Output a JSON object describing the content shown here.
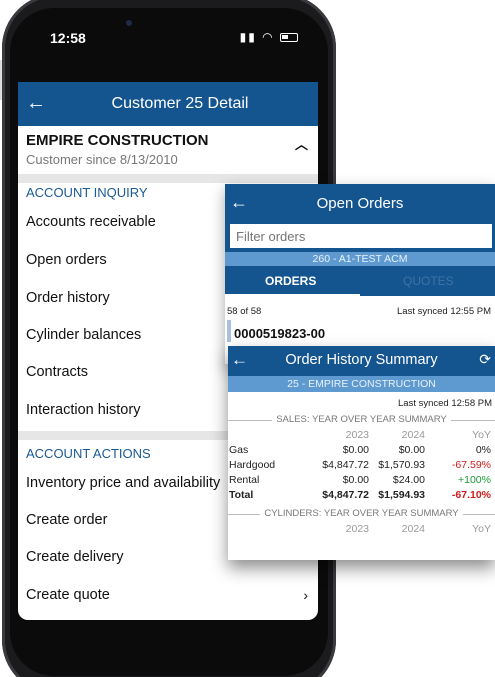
{
  "status_bar": {
    "time": "12:58"
  },
  "customer_screen": {
    "title": "Customer 25 Detail",
    "customer_name": "EMPIRE CONSTRUCTION",
    "customer_since": "Customer since 8/13/2010",
    "account_inquiry": {
      "heading": "ACCOUNT INQUIRY",
      "items": [
        "Accounts receivable",
        "Open orders",
        "Order history",
        "Cylinder balances",
        "Contracts",
        "Interaction history"
      ]
    },
    "account_actions": {
      "heading": "ACCOUNT ACTIONS",
      "items": [
        "Inventory price and availability",
        "Create order",
        "Create delivery",
        "Create quote"
      ]
    }
  },
  "open_orders": {
    "title": "Open Orders",
    "filter_placeholder": "Filter orders",
    "location": "260 - A1-TEST ACM",
    "tabs": [
      "ORDERS",
      "QUOTES"
    ],
    "count": "58 of 58",
    "last_synced": "Last synced 12:55 PM",
    "first_order": "0000519823-00"
  },
  "order_history": {
    "title": "Order History Summary",
    "customer": "25 - EMPIRE CONSTRUCTION",
    "last_synced": "Last synced 12:58 PM",
    "sales_section": "SALES: YEAR OVER YEAR SUMMARY",
    "columns": [
      "2023",
      "2024",
      "YoY"
    ],
    "rows": [
      {
        "label": "Gas",
        "y2023": "$0.00",
        "y2024": "$0.00",
        "yoy": "0%",
        "trend": "flat"
      },
      {
        "label": "Hardgood",
        "y2023": "$4,847.72",
        "y2024": "$1,570.93",
        "yoy": "-67.59%",
        "trend": "down"
      },
      {
        "label": "Rental",
        "y2023": "$0.00",
        "y2024": "$24.00",
        "yoy": "+100%",
        "trend": "up"
      },
      {
        "label": "Total",
        "y2023": "$4,847.72",
        "y2024": "$1,594.93",
        "yoy": "-67.10%",
        "trend": "down"
      }
    ],
    "cylinders_section": "CYLINDERS: YEAR OVER YEAR SUMMARY",
    "cylinder_columns": [
      "2023",
      "2024",
      "YoY"
    ]
  },
  "colors": {
    "header_blue": "#14548f",
    "strip_blue": "#5e9ad0",
    "negative": "#d21b1b",
    "positive": "#1b9a3a"
  },
  "icons": [
    "back-arrow-icon",
    "chevron-up-icon",
    "chevron-right-icon",
    "refresh-icon",
    "wifi-icon",
    "signal-icon",
    "battery-icon"
  ]
}
